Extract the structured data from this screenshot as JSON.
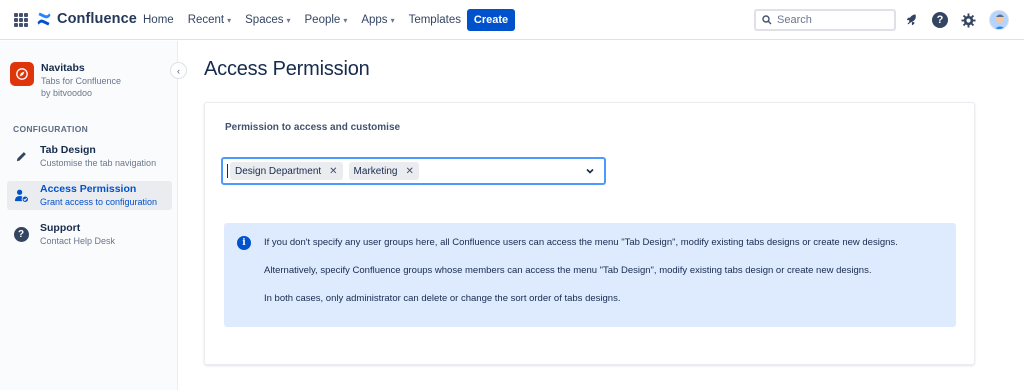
{
  "nav": {
    "brand": "Confluence",
    "items": [
      {
        "label": "Home",
        "has_dropdown": false
      },
      {
        "label": "Recent",
        "has_dropdown": true
      },
      {
        "label": "Spaces",
        "has_dropdown": true
      },
      {
        "label": "People",
        "has_dropdown": true
      },
      {
        "label": "Apps",
        "has_dropdown": true
      },
      {
        "label": "Templates",
        "has_dropdown": false
      }
    ],
    "create_label": "Create",
    "search_placeholder": "Search",
    "icons": [
      "notifications-icon",
      "help-icon",
      "settings-icon",
      "avatar"
    ]
  },
  "sidebar": {
    "app_name": "Navitabs",
    "app_tagline": "Tabs for Confluence",
    "app_vendor": "by bitvoodoo",
    "section_label": "CONFIGURATION",
    "items": [
      {
        "title": "Tab Design",
        "desc": "Customise the tab navigation",
        "icon": "pencil-icon",
        "active": false
      },
      {
        "title": "Access Permission",
        "desc": "Grant access to configuration",
        "icon": "user-permission-icon",
        "active": true
      },
      {
        "title": "Support",
        "desc": "Contact Help Desk",
        "icon": "question-icon",
        "active": false
      }
    ]
  },
  "main": {
    "title": "Access Permission",
    "field_label": "Permission to access and customise",
    "selected_groups": [
      "Design Department",
      "Marketing"
    ],
    "info_lines": [
      "If you don't specify any user groups here, all Confluence users can access the menu \"Tab Design\", modify existing tabs designs or create new designs.",
      "Alternatively, specify Confluence groups whose members can access the menu \"Tab Design\", modify existing tabs design or create new designs.",
      "In both cases, only administrator can delete or change the sort order of tabs designs."
    ]
  },
  "colors": {
    "primary": "#0052CC",
    "info_bg": "#DEEBFF",
    "focus_border": "#4C9AFF",
    "app_logo": "#DE350B"
  }
}
